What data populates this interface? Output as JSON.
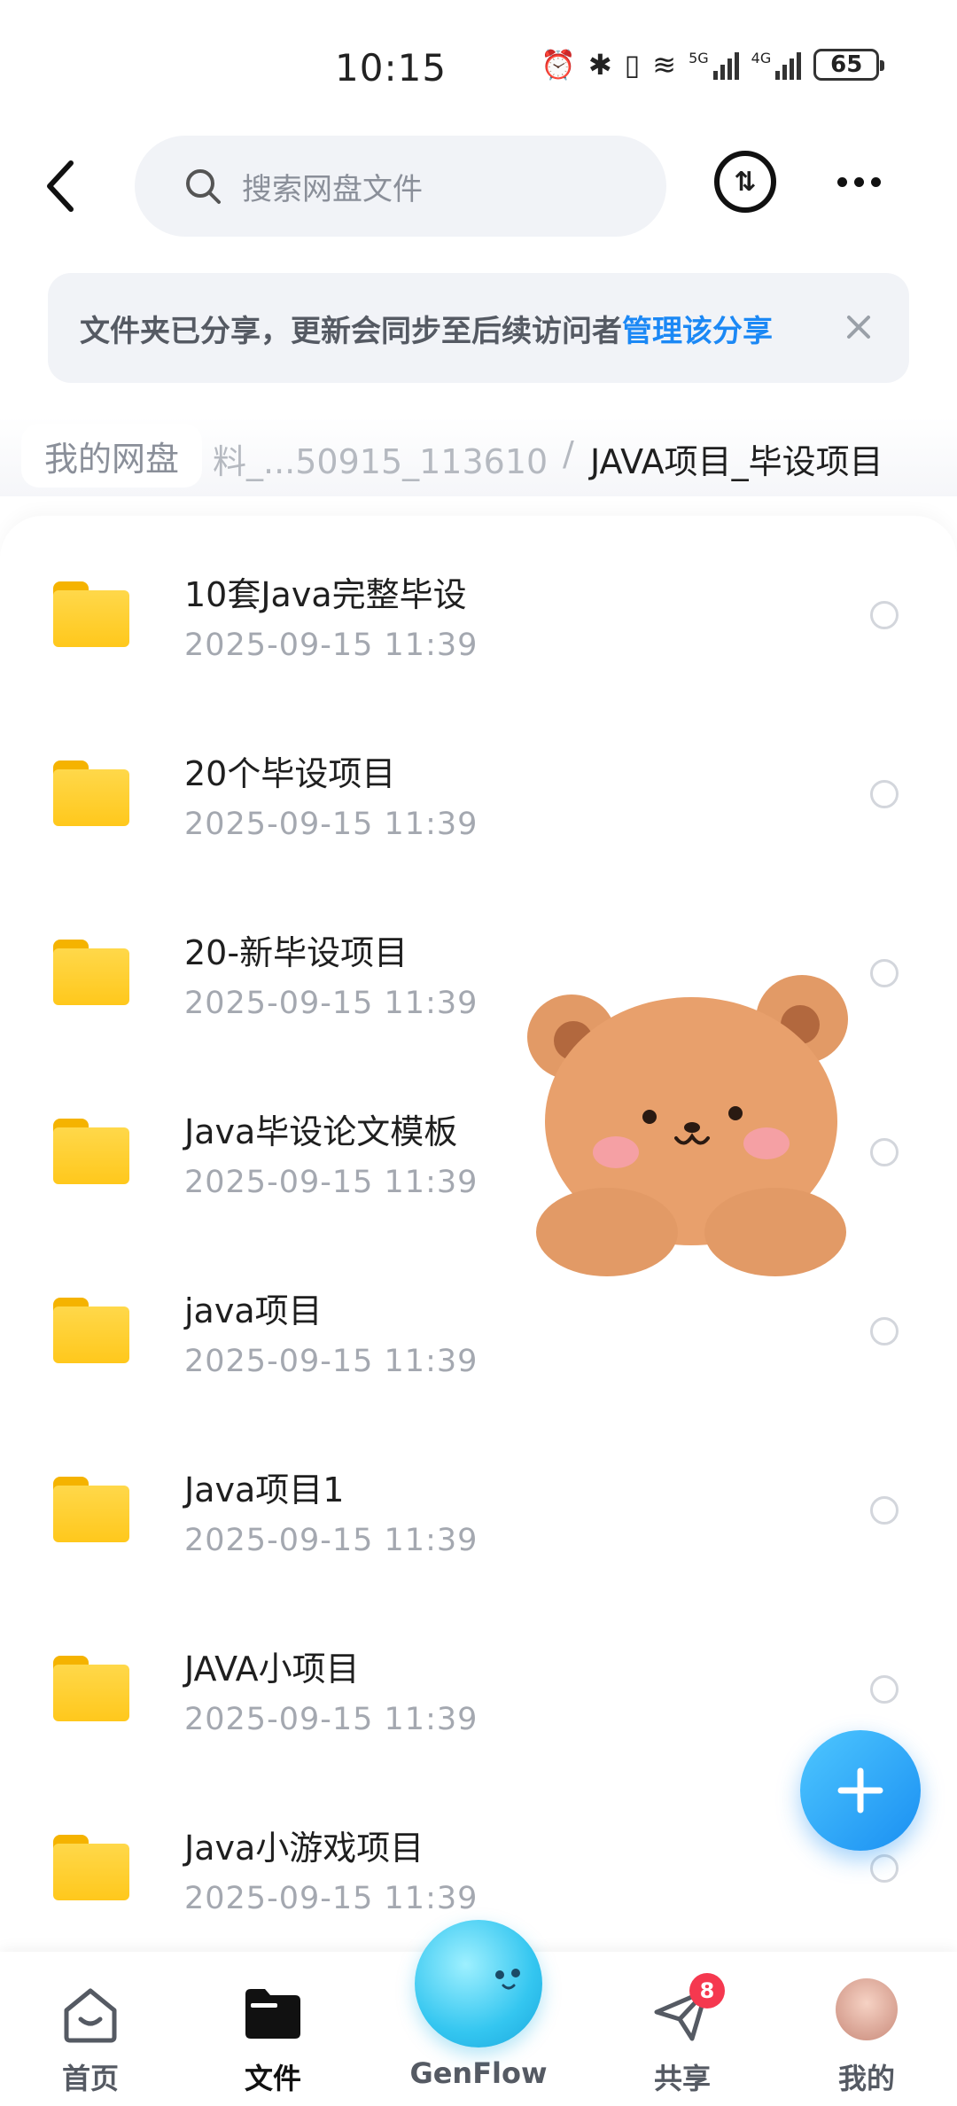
{
  "status_bar": {
    "time": "10:15",
    "battery": "65",
    "net_5g": "5G",
    "net_4g": "4G"
  },
  "header": {
    "search_placeholder": "搜索网盘文件"
  },
  "notice": {
    "text": "文件夹已分享，更新会同步至后续访问者",
    "link": "管理该分享"
  },
  "breadcrumb": {
    "root": "我的网盘",
    "middle": "料_...50915_113610",
    "separator": "/",
    "current": "JAVA项目_毕设项目"
  },
  "files": [
    {
      "name": "10套Java完整毕设",
      "date": "2025-09-15  11:39"
    },
    {
      "name": "20个毕设项目",
      "date": "2025-09-15  11:39"
    },
    {
      "name": "20-新毕设项目",
      "date": "2025-09-15  11:39"
    },
    {
      "name": "Java毕设论文模板",
      "date": "2025-09-15  11:39"
    },
    {
      "name": "java项目",
      "date": "2025-09-15  11:39"
    },
    {
      "name": "Java项目1",
      "date": "2025-09-15  11:39"
    },
    {
      "name": "JAVA小项目",
      "date": "2025-09-15  11:39"
    },
    {
      "name": "Java小游戏项目",
      "date": "2025-09-15  11:39"
    }
  ],
  "nav": {
    "home": "首页",
    "files": "文件",
    "genflow": "GenFlow",
    "share": "共享",
    "share_badge": "8",
    "me": "我的"
  },
  "colors": {
    "accent": "#1b88f5",
    "folder": "#ffc81c",
    "badge": "#f5384f"
  }
}
